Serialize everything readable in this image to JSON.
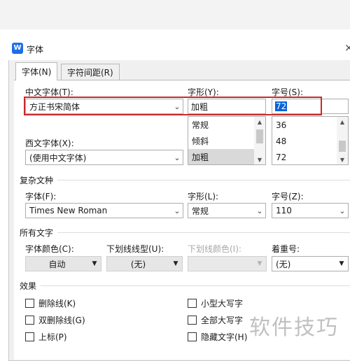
{
  "dialog": {
    "title": "字体",
    "app_icon": "W",
    "close_glyph": "×"
  },
  "tabs": [
    {
      "label": "字体(N)",
      "active": true
    },
    {
      "label": "字符间距(R)",
      "active": false
    }
  ],
  "chinese_font": {
    "label": "中文字体(T):",
    "value": "方正书宋简体"
  },
  "style": {
    "label": "字形(Y):",
    "value": "加粗",
    "options": [
      "常规",
      "倾斜",
      "加粗"
    ],
    "selected": "加粗"
  },
  "size": {
    "label": "字号(S):",
    "value": "72",
    "options": [
      "36",
      "48",
      "72"
    ],
    "selected": "72"
  },
  "western_font": {
    "label": "西文字体(X):",
    "value": "(使用中文字体)"
  },
  "complex": {
    "section_title": "复杂文种",
    "font_label": "字体(F):",
    "font_value": "Times New Roman",
    "style_label": "字形(L):",
    "style_value": "常规",
    "size_label": "字号(Z):",
    "size_value": "110"
  },
  "all_text": {
    "section_title": "所有文字",
    "color_label": "字体颜色(C):",
    "color_value": "自动",
    "underline_label": "下划线线型(U):",
    "underline_value": "(无)",
    "underline_color_label": "下划线颜色(I):",
    "emphasis_label": "着重号:",
    "emphasis_value": "(无)"
  },
  "effects": {
    "section_title": "效果",
    "left": [
      "删除线(K)",
      "双删除线(G)",
      "上标(P)"
    ],
    "right": [
      "小型大写字",
      "全部大写字",
      "隐藏文字(H)"
    ]
  },
  "watermark": "软件技巧",
  "icons": {
    "dropdown": "chevron-down-icon",
    "scroll_up": "triangle-up-icon",
    "scroll_down": "triangle-down-icon"
  },
  "colors": {
    "highlight_border": "#cc2929",
    "selection": "#0a64d8"
  }
}
